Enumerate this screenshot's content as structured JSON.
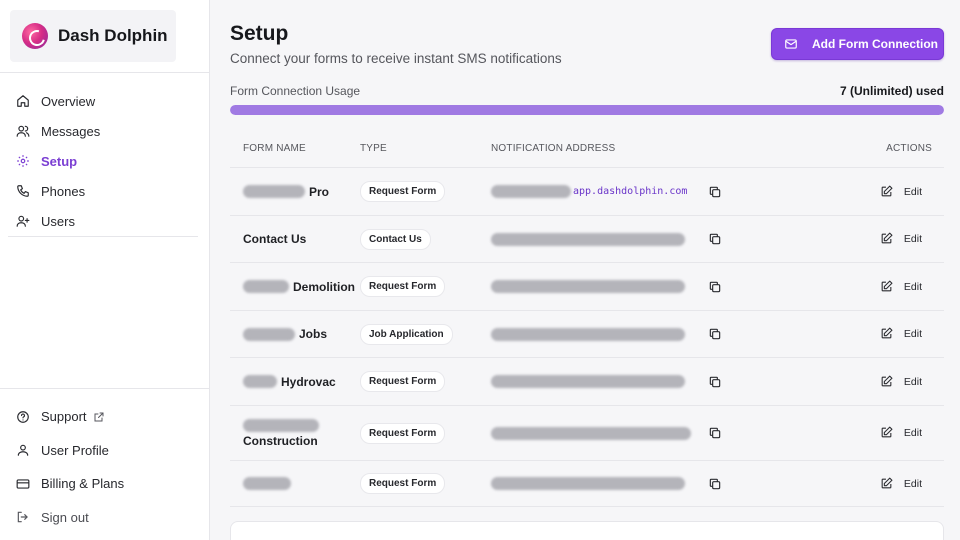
{
  "brand": {
    "name": "Dash Dolphin"
  },
  "nav": [
    {
      "label": "Overview",
      "icon": "home-icon",
      "active": false
    },
    {
      "label": "Messages",
      "icon": "users-icon",
      "active": false
    },
    {
      "label": "Setup",
      "icon": "gear-icon",
      "active": true
    },
    {
      "label": "Phones",
      "icon": "phone-icon",
      "active": false
    },
    {
      "label": "Users",
      "icon": "user-plus-icon",
      "active": false
    }
  ],
  "bottom_nav": [
    {
      "label": "Support",
      "icon": "help-circle-icon"
    },
    {
      "label": "User Profile",
      "icon": "user-icon"
    },
    {
      "label": "Billing & Plans",
      "icon": "credit-card-icon"
    },
    {
      "label": "Sign out",
      "icon": "sign-out-icon"
    }
  ],
  "header": {
    "title": "Setup",
    "subtitle": "Connect your forms to receive instant SMS notifications",
    "add_button": "Add Form Connection"
  },
  "usage": {
    "label": "Form Connection Usage",
    "value": "7 (Unlimited) used",
    "fill_percent": 100,
    "accent": "#8a47e6"
  },
  "table": {
    "columns": [
      "FORM NAME",
      "TYPE",
      "NOTIFICATION ADDRESS",
      "ACTIONS"
    ],
    "edit_label": "Edit",
    "rows": [
      {
        "name": "Pro",
        "type": "Request Form",
        "address_suffix": "app.dashdolphin.com"
      },
      {
        "name": "Contact Us",
        "type": "Contact Us",
        "address_suffix": ""
      },
      {
        "name": "Demolition",
        "type": "Request Form",
        "address_suffix": ""
      },
      {
        "name": "Jobs",
        "type": "Job Application",
        "address_suffix": ""
      },
      {
        "name": "Hydrovac",
        "type": "Request Form",
        "address_suffix": ""
      },
      {
        "name": "Construction",
        "type": "Request Form",
        "address_suffix": ""
      },
      {
        "name": "",
        "type": "Request Form",
        "address_suffix": ""
      }
    ]
  }
}
